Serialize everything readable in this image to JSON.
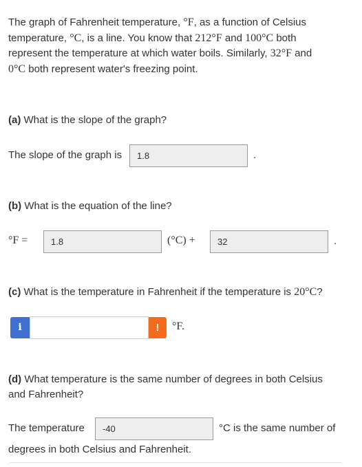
{
  "intro": {
    "l1a": "The graph of Fahrenheit temperature, ",
    "deg_F": "°F",
    "l1b": ", as a function of Celsius",
    "l2a": "temperature, ",
    "deg_C": "°C",
    "l2b": ", is a line. You know that ",
    "t212": "212°F",
    "l2c": " and ",
    "t100": "100°C",
    "l2d": " both",
    "l3": "represent the temperature at which water boils. Similarly, ",
    "t32": "32°F",
    "l3b": " and",
    "t0": "0°C",
    "l4": " both represent water's freezing point."
  },
  "part_a": {
    "label": "(a)",
    "question": " What is the slope of the graph?",
    "prefix": "The slope of the graph is",
    "answer": "1.8",
    "suffix": "."
  },
  "part_b": {
    "label": "(b)",
    "question": " What is the equation of the line?",
    "lhs": "°F =",
    "answer_slope": "1.8",
    "middle": "(°C) +",
    "answer_intercept": "32",
    "suffix": "."
  },
  "part_c": {
    "label": "(c)",
    "question": " What is the temperature in Fahrenheit if the temperature is ",
    "temp": "20°C",
    "qmark": "?",
    "info_icon": "i",
    "warn_icon": "!",
    "answer": "",
    "unit": "°F."
  },
  "part_d": {
    "label": "(d)",
    "question_l1": " What temperature is the same number of degrees in both Celsius",
    "question_l2": "and Fahrenheit?",
    "prefix": "The temperature",
    "answer": "-40",
    "suffix_l1": "°C is the same number of",
    "suffix_l2": "degrees in both Celsius and Fahrenheit."
  }
}
